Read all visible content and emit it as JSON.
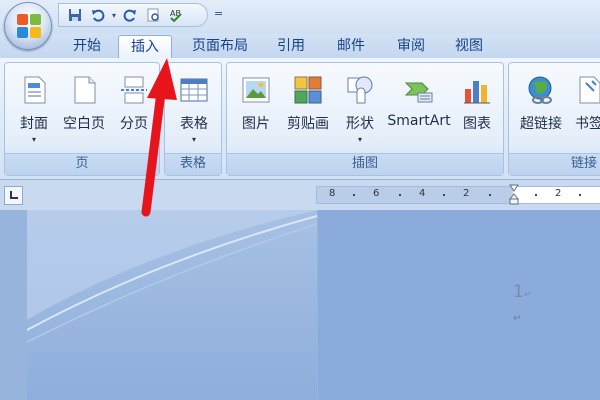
{
  "tabs": [
    {
      "label": "开始",
      "active": false
    },
    {
      "label": "插入",
      "active": true
    },
    {
      "label": "页面布局",
      "active": false
    },
    {
      "label": "引用",
      "active": false
    },
    {
      "label": "邮件",
      "active": false
    },
    {
      "label": "审阅",
      "active": false
    },
    {
      "label": "视图",
      "active": false
    }
  ],
  "quick_access": {
    "icons": [
      "save-icon",
      "undo-icon",
      "redo-icon",
      "print-preview-icon",
      "spelling-icon"
    ],
    "dropdown": "▾",
    "more": "="
  },
  "ribbon": {
    "groups": [
      {
        "label": "页",
        "buttons": [
          {
            "label": "封面",
            "icon": "cover-page-icon",
            "dropdown": "▾"
          },
          {
            "label": "空白页",
            "icon": "blank-page-icon"
          },
          {
            "label": "分页",
            "icon": "page-break-icon"
          }
        ]
      },
      {
        "label": "表格",
        "buttons": [
          {
            "label": "表格",
            "icon": "table-icon",
            "dropdown": "▾"
          }
        ]
      },
      {
        "label": "插图",
        "buttons": [
          {
            "label": "图片",
            "icon": "picture-icon"
          },
          {
            "label": "剪贴画",
            "icon": "clip-art-icon"
          },
          {
            "label": "形状",
            "icon": "shapes-icon",
            "dropdown": "▾"
          },
          {
            "label": "SmartArt",
            "icon": "smartart-icon"
          },
          {
            "label": "图表",
            "icon": "chart-icon"
          }
        ]
      },
      {
        "label": "链接",
        "buttons": [
          {
            "label": "超链接",
            "icon": "hyperlink-icon"
          },
          {
            "label": "书签",
            "icon": "bookmark-icon"
          }
        ]
      }
    ]
  },
  "ruler": {
    "numbers": [
      "8",
      "6",
      "4",
      "2",
      "2"
    ]
  },
  "document": {
    "page_number": "1",
    "paragraph_marks": [
      "↵",
      "↵"
    ]
  },
  "colors": {
    "tab_text": "#15428b",
    "arrow": "#e8141c",
    "ribbon_label": "#3b5f91"
  }
}
